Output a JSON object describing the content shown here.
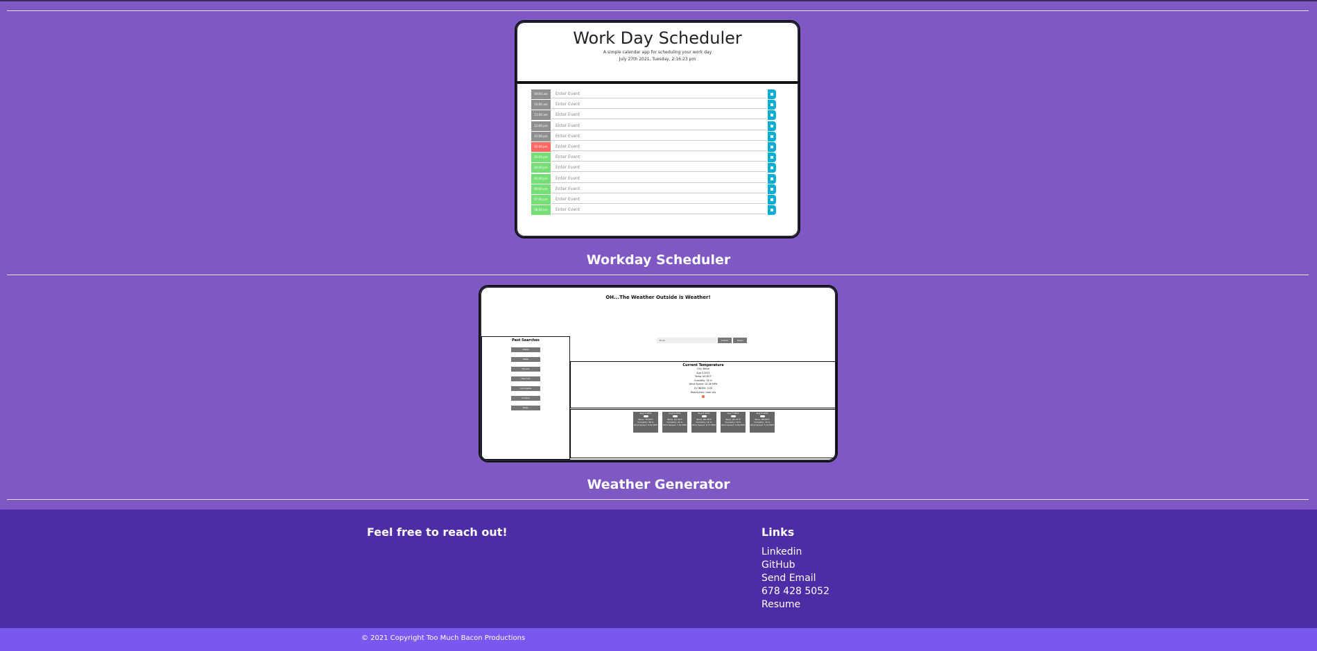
{
  "projects": [
    {
      "title": "Workday Scheduler"
    },
    {
      "title": "Weather Generator"
    }
  ],
  "scheduler": {
    "title": "Work Day Scheduler",
    "subtitle": "A simple calendar app for scheduling your work day",
    "date": "July 27th 2021, Tuesday, 2:16:23 pm",
    "placeholder": "Enter Event",
    "rows": [
      {
        "hour": "09:00 am",
        "state": "past"
      },
      {
        "hour": "10:00 am",
        "state": "past"
      },
      {
        "hour": "11:00 am",
        "state": "past"
      },
      {
        "hour": "12:00 pm",
        "state": "past"
      },
      {
        "hour": "01:00 pm",
        "state": "past"
      },
      {
        "hour": "02:00 pm",
        "state": "present"
      },
      {
        "hour": "03:00 pm",
        "state": "future"
      },
      {
        "hour": "04:00 pm",
        "state": "future"
      },
      {
        "hour": "05:00 pm",
        "state": "future"
      },
      {
        "hour": "06:00 pm",
        "state": "future"
      },
      {
        "hour": "07:00 pm",
        "state": "future"
      },
      {
        "hour": "08:00 pm",
        "state": "future"
      }
    ]
  },
  "weather": {
    "title": "OH...The Weather Outside is Weather!",
    "past_searches_label": "Past Searches",
    "cities": [
      "Atlanta",
      "Dallas",
      "Phoenix",
      "New York",
      "Los Angeles",
      "Portland",
      "Boise"
    ],
    "search_value": "Boise",
    "submit_label": "Submit",
    "reset_label": "Reset",
    "current_heading": "Current Temperature",
    "current_lines": [
      "City: Boise",
      "Aug 3 2021",
      "Temp: 84.63 F",
      "Humidity: 18 %",
      "Wind Speed: 10.36 MPH",
      "UV INDEX: 0.00",
      "Description: clear sky"
    ],
    "forecast": [
      {
        "date": "Aug 4 2021",
        "temp": "Temp: 75.99°F",
        "humidity": "Humidity: 38 %",
        "wind": "Wind Speed: 6.09 MPH"
      },
      {
        "date": "Aug 5 2021",
        "temp": "Temp: 81.39°F",
        "humidity": "Humidity: 24 %",
        "wind": "Wind Speed: 7.34 MPH"
      },
      {
        "date": "Aug 6 2021",
        "temp": "Temp: 86.39°F",
        "humidity": "Humidity: 16 %",
        "wind": "Wind Speed: 6.77 MPH"
      },
      {
        "date": "Aug 7 2021",
        "temp": "Temp: 87.21°F",
        "humidity": "Humidity: 18 %",
        "wind": "Wind Speed: 9.36 MPH"
      },
      {
        "date": "Aug 8 2021",
        "temp": "Temp: 88.66°F",
        "humidity": "Humidity: 16 %",
        "wind": "Wind Speed: 5.14 MPH"
      }
    ]
  },
  "footer": {
    "reach_out": "Feel free to reach out!",
    "links_heading": "Links",
    "links": [
      "Linkedin",
      "GitHub",
      "Send Email",
      "678 428 5052",
      "Resume"
    ],
    "copyright": "© 2021 Copyright Too Much Bacon Productions"
  },
  "colors": {
    "background": "#7e59c4",
    "footer": "#4e2ca5",
    "copyright_bar": "#7b57f2",
    "past": "#8f8f8f",
    "present": "#ff6961",
    "future": "#77dd77",
    "save": "#06aed5"
  }
}
